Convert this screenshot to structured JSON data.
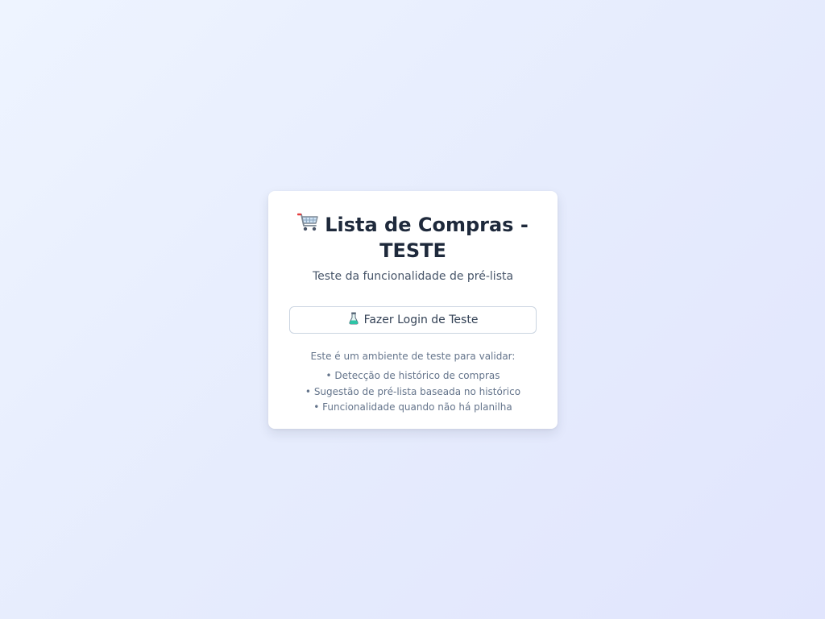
{
  "card": {
    "cart_icon": "shopping-cart-icon",
    "title": "Lista de Compras - TESTE",
    "subtitle": "Teste da funcionalidade de pré-lista",
    "login_button": {
      "icon": "test-tube-icon",
      "label": "Fazer Login de Teste"
    },
    "info": {
      "intro": "Este é um ambiente de teste para validar:",
      "items": [
        "• Detecção de histórico de compras",
        "• Sugestão de pré-lista baseada no histórico",
        "• Funcionalidade quando não há planilha"
      ]
    }
  },
  "colors": {
    "background_from": "#eef4ff",
    "background_to": "#e1e5fd",
    "card": "#ffffff",
    "title": "#1e293b",
    "muted": "#64748b",
    "button_border": "#cbd5e1"
  }
}
